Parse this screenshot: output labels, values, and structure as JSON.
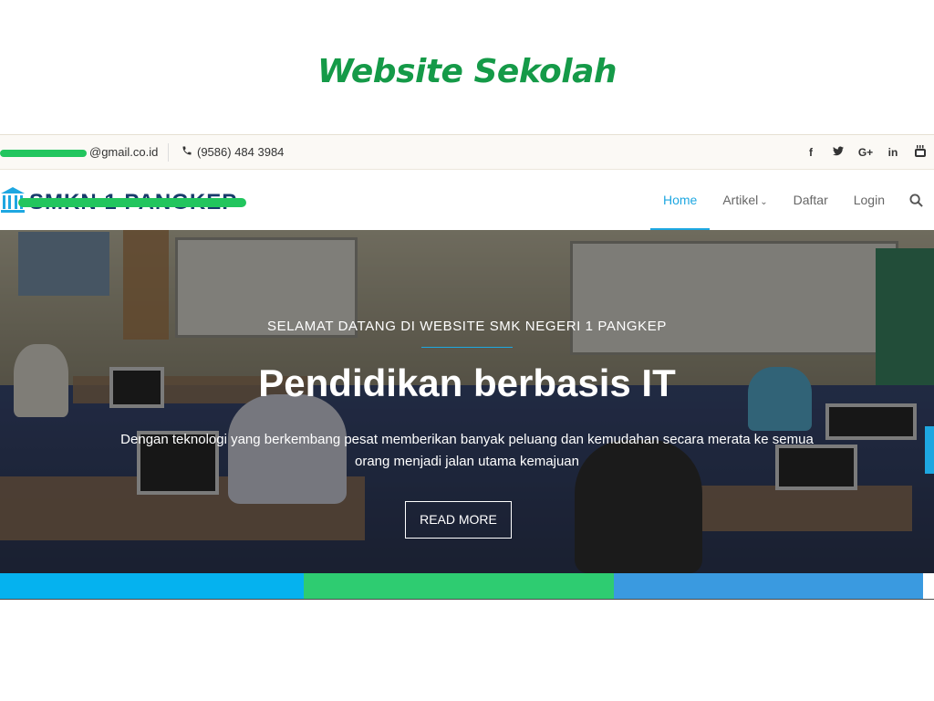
{
  "heading": "Website Sekolah",
  "topbar": {
    "email": "@gmail.co.id",
    "phone": "(9586) 484 3984",
    "social": [
      {
        "icon": "facebook-icon",
        "glyph": "f"
      },
      {
        "icon": "twitter-icon",
        "glyph": "t"
      },
      {
        "icon": "google-plus-icon",
        "glyph": "G+"
      },
      {
        "icon": "linkedin-icon",
        "glyph": "in"
      },
      {
        "icon": "youtube-icon",
        "glyph": "▶"
      }
    ]
  },
  "navbar": {
    "logo_text": "SMKN 1 PANGKEP",
    "items": [
      {
        "label": "Home",
        "active": true
      },
      {
        "label": "Artikel",
        "has_dropdown": true
      },
      {
        "label": "Daftar"
      },
      {
        "label": "Login"
      }
    ]
  },
  "hero": {
    "kicker": "SELAMAT DATANG DI WEBSITE SMK NEGERI 1 PANGKEP",
    "headline": "Pendidikan berbasis IT",
    "description": "Dengan teknologi yang berkembang pesat memberikan banyak peluang dan kemudahan secara merata ke semua orang menjadi jalan utama kemajuan",
    "cta_label": "READ MORE"
  },
  "colors": {
    "brand_green": "#159a48",
    "accent_blue": "#1ea7e1",
    "strip": [
      "#05b2ef",
      "#2ecc71",
      "#3a9ae0"
    ]
  }
}
